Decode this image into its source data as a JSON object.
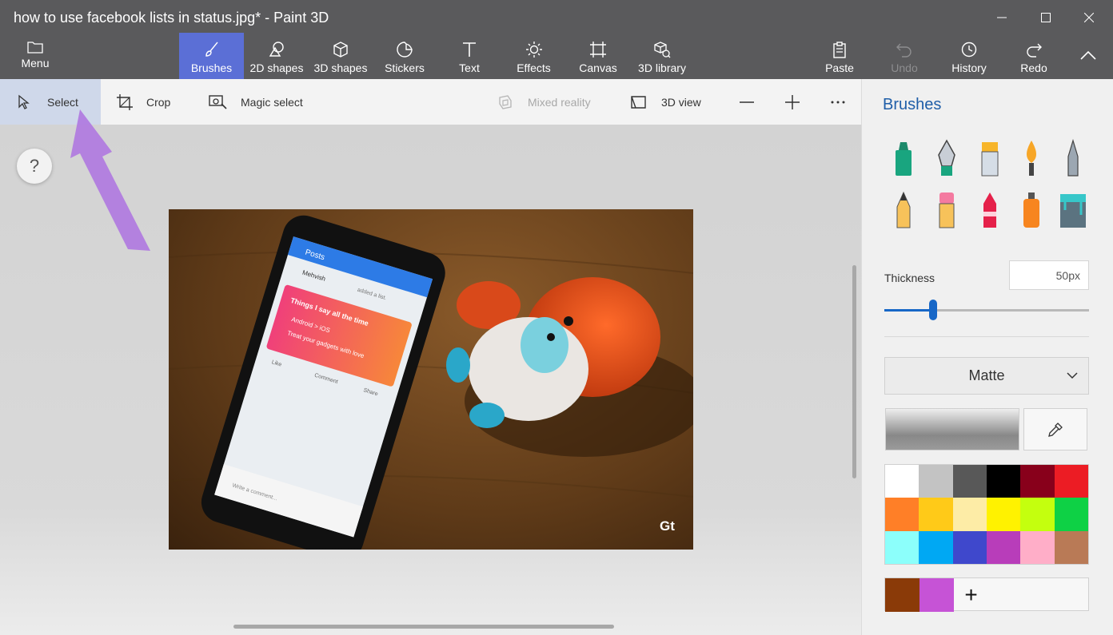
{
  "window": {
    "title": "how to use facebook lists in status.jpg* - Paint 3D"
  },
  "ribbon": {
    "menu_label": "Menu",
    "tools": [
      {
        "label": "Brushes",
        "icon": "brush-icon",
        "active": true
      },
      {
        "label": "2D shapes",
        "icon": "2d-shapes-icon"
      },
      {
        "label": "3D shapes",
        "icon": "3d-shapes-icon"
      },
      {
        "label": "Stickers",
        "icon": "stickers-icon"
      },
      {
        "label": "Text",
        "icon": "text-icon"
      },
      {
        "label": "Effects",
        "icon": "effects-icon"
      },
      {
        "label": "Canvas",
        "icon": "canvas-icon"
      },
      {
        "label": "3D library",
        "icon": "3d-library-icon"
      }
    ],
    "paste_label": "Paste",
    "undo_label": "Undo",
    "history_label": "History",
    "redo_label": "Redo"
  },
  "subbar": {
    "select_label": "Select",
    "crop_label": "Crop",
    "magic_select_label": "Magic select",
    "mixed_reality_label": "Mixed reality",
    "view3d_label": "3D view"
  },
  "help_label": "?",
  "photo": {
    "phone_header": "Posts",
    "phone_user": "Mehvish",
    "phone_added": "added a list.",
    "list_title": "Things I say all the time",
    "list_item_1": "Android > iOS",
    "list_item_2": "Treat your gadgets with love",
    "like_label": "Like",
    "comment_label": "Comment",
    "share_label": "Share",
    "write_comment": "Write a comment...",
    "watermark": "Gt"
  },
  "panel": {
    "title": "Brushes",
    "brushes": [
      "marker-icon",
      "calligraphy-pen-icon",
      "oil-brush-icon",
      "watercolor-icon",
      "pixel-pen-icon",
      "pencil-icon",
      "eraser-icon",
      "crayon-icon",
      "spray-can-icon",
      "fill-bucket-icon"
    ],
    "thickness_label": "Thickness",
    "thickness_value": "50px",
    "thickness_fraction": 0.24,
    "finish": "Matte",
    "palette": [
      "#ffffff",
      "#c3c3c3",
      "#585858",
      "#000000",
      "#88001b",
      "#ec1c24",
      "#ff7f27",
      "#ffca18",
      "#fdeca6",
      "#fff200",
      "#c4ff0e",
      "#0ed145",
      "#8cfffb",
      "#00a8f3",
      "#3f48cc",
      "#b83dba",
      "#ffaec8",
      "#b97a56"
    ],
    "custom_colors": [
      "#8a3a08",
      "#c653d6"
    ],
    "add_color_label": "+"
  },
  "accent_color": "#5b6fd6",
  "annotation_arrow_color": "#b07ae0"
}
